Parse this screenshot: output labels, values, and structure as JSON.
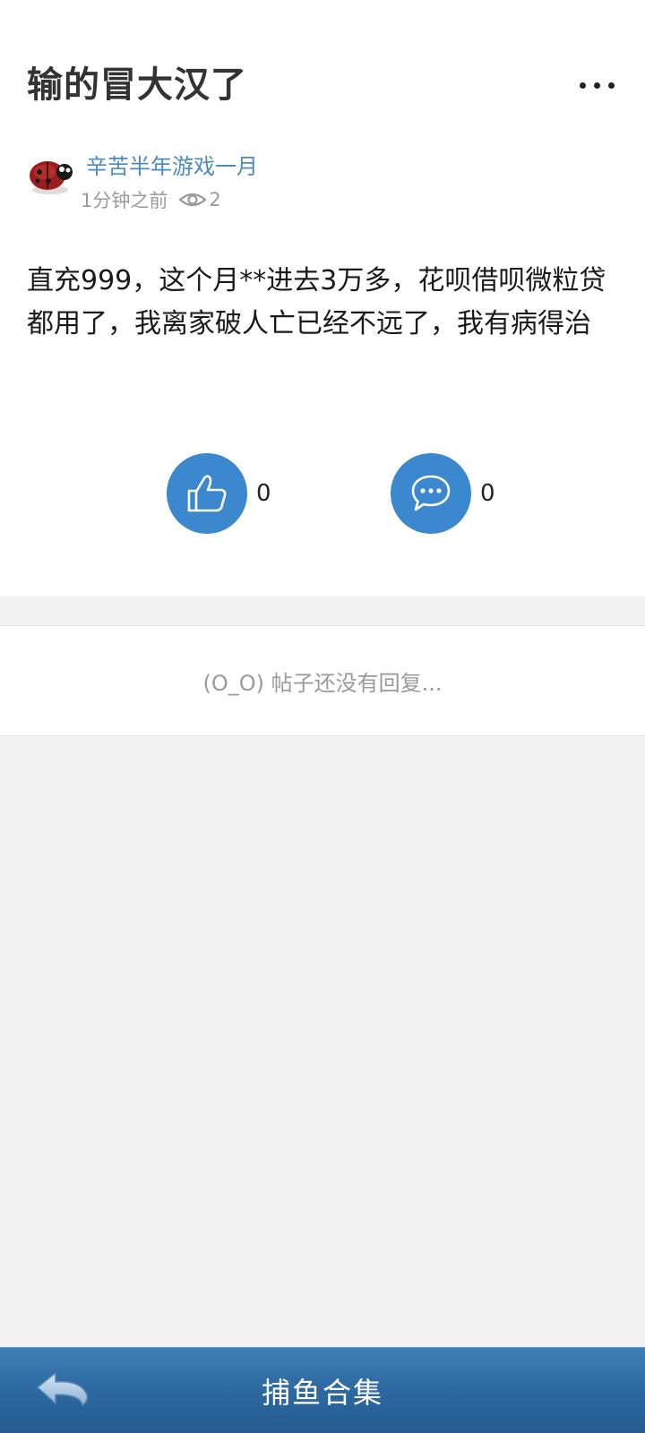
{
  "post": {
    "title": "输的冒大汉了",
    "author": "辛苦半年游戏一月",
    "time": "1分钟之前",
    "views": "2",
    "body": "直充999，这个月**进去3万多，花呗借呗微粒贷都用了，我离家破人亡已经不远了，我有病得治",
    "likes": "0",
    "comments": "0"
  },
  "replies": {
    "empty_text": "(O_O) 帖子还没有回复..."
  },
  "bottom_bar": {
    "title": "捕鱼合集"
  },
  "icons": {
    "more": "more-dots-icon",
    "views": "eye-icon",
    "like": "thumbs-up-icon",
    "comment": "chat-bubble-icon",
    "back": "back-arrow-icon"
  },
  "colors": {
    "accent": "#3b88cf",
    "author_link": "#4a8bc2",
    "bar": "#2f6aa2"
  }
}
